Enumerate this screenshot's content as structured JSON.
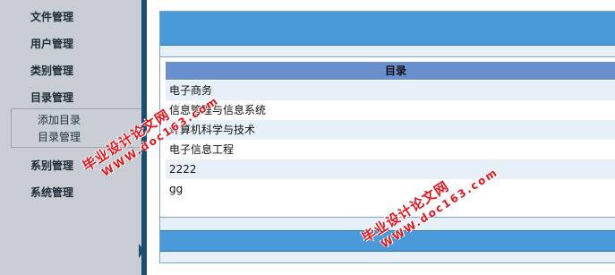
{
  "sidebar": {
    "items": [
      {
        "label": "文件管理"
      },
      {
        "label": "用户管理"
      },
      {
        "label": "类别管理"
      },
      {
        "label": "目录管理"
      },
      {
        "label": "系别管理"
      },
      {
        "label": "系统管理"
      }
    ],
    "submenu": [
      {
        "label": "添加目录"
      },
      {
        "label": "目录管理"
      }
    ]
  },
  "main": {
    "column_header": "目录",
    "rows": [
      {
        "name": "电子商务"
      },
      {
        "name": "信息管理与信息系统"
      },
      {
        "name": "计算机科学与技术"
      },
      {
        "name": "电子信息工程"
      },
      {
        "name": "2222"
      },
      {
        "name": "gg"
      }
    ]
  },
  "watermark": {
    "title": "毕业设计论文网",
    "url": "WWW.doc163.com"
  },
  "colors": {
    "sidebar_bg": "#c7cdd2",
    "divider": "#1d4d6e",
    "bar_blue": "#4a9ad9",
    "header_blue": "#6a8fcf",
    "row_alt": "#e7f0f9",
    "watermark_red": "#e8151b"
  }
}
